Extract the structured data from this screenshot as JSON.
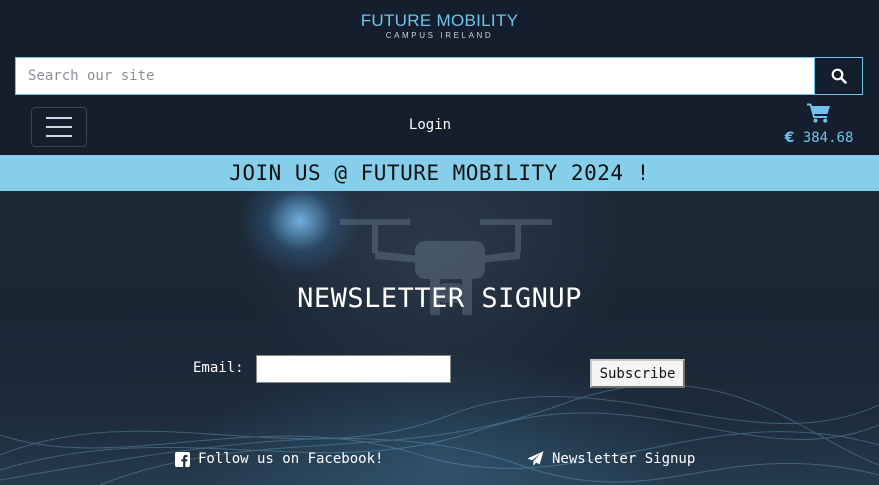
{
  "logo": {
    "main": "FUTURE MOBILITY",
    "sub": "CAMPUS IRELAND"
  },
  "search": {
    "placeholder": "Search our site",
    "value": ""
  },
  "nav": {
    "login_label": "Login"
  },
  "cart": {
    "currency_symbol": "€",
    "total": "384.68"
  },
  "banner": {
    "text": "JOIN US @ FUTURE MOBILITY 2024 !"
  },
  "newsletter": {
    "title": "NEWSLETTER SIGNUP",
    "email_label": "Email:",
    "email_value": "",
    "subscribe_label": "Subscribe"
  },
  "footer_links": {
    "facebook_label": "Follow us on Facebook!",
    "newsletter_label": "Newsletter Signup"
  },
  "icons": {
    "search": "search-icon",
    "menu": "hamburger-menu-icon",
    "cart": "shopping-cart-icon",
    "facebook": "facebook-icon",
    "newsletter": "paper-plane-icon"
  },
  "colors": {
    "accent": "#6ec4ea",
    "header_bg": "#141e2c",
    "banner_bg": "#87ceeb"
  }
}
